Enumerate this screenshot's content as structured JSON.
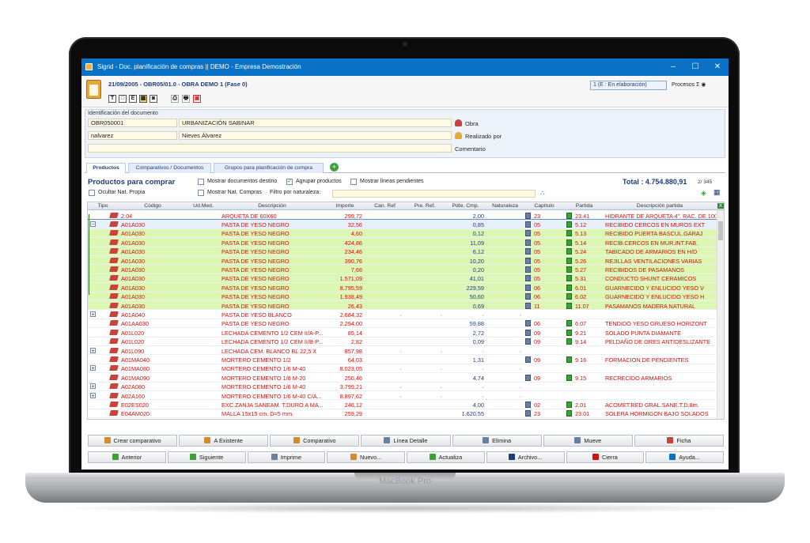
{
  "device": {
    "brand": "MacBook Pro"
  },
  "window": {
    "title": "Sigrid - Doc. planificación de compras || DEMO - Empresa Demostración",
    "min": "–",
    "max": "☐",
    "close": "✕"
  },
  "header": {
    "doc_ref": "21/09/2005 - OBR05/01.0 - OBRA DEMO 1 (Fase 0)",
    "state": "1 (E : En elaboración)",
    "procesos": "Procesos",
    "toolbar_icons": [
      "T",
      "□",
      "E",
      "▦",
      "◙",
      "⎙",
      "🖶",
      "▣"
    ]
  },
  "ident": {
    "label": "Identificación del documento",
    "obra_code": "OBR050001",
    "obra_name": "URBANIZACIÓN SABINAR",
    "obra_label": "Obra",
    "user_code": "nalvarez",
    "user_name": "Nieves Álvarez",
    "realizado_label": "Realizado por",
    "comentario_label": "Comentario"
  },
  "tabs": [
    "Productos",
    "Comparativos / Documentos",
    "Grupos para planificación de compra"
  ],
  "products": {
    "title": "Productos para comprar",
    "opts": {
      "ocultar": "Ocultar Nat. Propia",
      "mostrar_docs": "Mostrar documentos destino",
      "agrupar": "Agrupar productos",
      "pendientes": "Mostrar líneas pendientes",
      "mostrar_nat": "Mostrar Nat. Compras",
      "filtro": "Filtro por naturaleza:"
    },
    "total": "Total : 4.754.880,91",
    "pager": "2/ 345"
  },
  "grid": {
    "headers": [
      "Tipo",
      "Código",
      "Ud.Med.",
      "Descripción",
      "Importe",
      "Can. Ref",
      "Pre. Ref.",
      "Pdte. Cmp.",
      "Naturaleza",
      "Capítulo",
      "Partida",
      "Descripción partida"
    ],
    "rows": [
      {
        "style": "normal",
        "exp": "",
        "code": "2.04",
        "desc": "ARQUETA DE 60X60",
        "imp": "299,72",
        "can": "",
        "pre": "",
        "pdte": "2,00",
        "nat": "",
        "cap": "23",
        "par": "23.41",
        "dpar": "HIDRANTE DE ARQUETA 4\". RAC. DE 100"
      },
      {
        "style": "sel",
        "exp": "−",
        "code": "A01A030",
        "desc": "PASTA DE YESO NEGRO",
        "imp": "32,56",
        "can": "",
        "pre": "",
        "pdte": "0,85",
        "nat": "",
        "cap": "05",
        "par": "5.12",
        "dpar": "RECIBIDO CERCOS EN MUROS EXT"
      },
      {
        "style": "green",
        "exp": "",
        "code": "A01A030",
        "desc": "PASTA DE YESO NEGRO",
        "imp": "4,60",
        "can": "",
        "pre": "",
        "pdte": "0,12",
        "nat": "",
        "cap": "05",
        "par": "5.13",
        "dpar": "RECIBIDO PUERTA BASCUL.GARAJ"
      },
      {
        "style": "green",
        "exp": "",
        "code": "A01A030",
        "desc": "PASTA DE YESO NEGRO",
        "imp": "424,86",
        "can": "",
        "pre": "",
        "pdte": "11,09",
        "nat": "",
        "cap": "05",
        "par": "5.14",
        "dpar": "RECIB.CERCOS EN MUR.INT.FAB."
      },
      {
        "style": "green",
        "exp": "",
        "code": "A01A030",
        "desc": "PASTA DE YESO NEGRO",
        "imp": "234,46",
        "can": "",
        "pre": "",
        "pdte": "6,12",
        "nat": "",
        "cap": "05",
        "par": "5.24",
        "dpar": "TABICADO DE ARMARIOS EN H/D"
      },
      {
        "style": "green",
        "exp": "",
        "code": "A01A030",
        "desc": "PASTA DE YESO NEGRO",
        "imp": "390,76",
        "can": "",
        "pre": "",
        "pdte": "10,20",
        "nat": "",
        "cap": "05",
        "par": "5.26",
        "dpar": "REJILLAS VENTILACIONES VARIAS"
      },
      {
        "style": "green",
        "exp": "",
        "code": "A01A030",
        "desc": "PASTA DE YESO NEGRO",
        "imp": "7,66",
        "can": "",
        "pre": "",
        "pdte": "0,20",
        "nat": "",
        "cap": "05",
        "par": "5.27",
        "dpar": "RECIBIDOS DE PASAMANOS"
      },
      {
        "style": "green",
        "exp": "",
        "code": "A01A030",
        "desc": "PASTA DE YESO NEGRO",
        "imp": "1.571,09",
        "can": "",
        "pre": "",
        "pdte": "41,01",
        "nat": "",
        "cap": "05",
        "par": "5.31",
        "dpar": "CONDUCTO SHUNT CERAMICOS"
      },
      {
        "style": "green",
        "exp": "",
        "code": "A01A030",
        "desc": "PASTA DE YESO NEGRO",
        "imp": "8.795,59",
        "can": "",
        "pre": "",
        "pdte": "229,59",
        "nat": "",
        "cap": "06",
        "par": "6.01",
        "dpar": "GUARNECIDO Y ENLUCIDO YESO V"
      },
      {
        "style": "green",
        "exp": "",
        "code": "A01A030",
        "desc": "PASTA DE YESO NEGRO",
        "imp": "1.938,49",
        "can": "",
        "pre": "",
        "pdte": "50,60",
        "nat": "",
        "cap": "06",
        "par": "6.02",
        "dpar": "GUARNECIDO Y ENLUCIDO YESO H"
      },
      {
        "style": "green",
        "exp": "",
        "code": "A01A030",
        "desc": "PASTA DE YESO NEGRO",
        "imp": "26,43",
        "can": "",
        "pre": "",
        "pdte": "0,69",
        "nat": "",
        "cap": "11",
        "par": "11.07",
        "dpar": "PASAMANOS MADERA NATURAL"
      },
      {
        "style": "gray",
        "exp": "+",
        "code": "A01A040",
        "desc": "PASTA DE YESO BLANCO",
        "imp": "2.684,32",
        "can": "·",
        "pre": "·",
        "pdte": "·",
        "nat": "·",
        "cap": "",
        "par": "",
        "dpar": ""
      },
      {
        "style": "normal",
        "exp": "",
        "code": "A01AA030",
        "desc": "PASTA DE YESO NEGRO",
        "imp": "2.294,00",
        "can": "",
        "pre": "",
        "pdte": "59,88",
        "nat": "",
        "cap": "06",
        "par": "6.07",
        "dpar": "TENDIDO YESO GRUESO HORIZONT"
      },
      {
        "style": "normal",
        "exp": "",
        "code": "A01L020",
        "desc": "LECHADA CEMENTO 1/2 CEM II/A-P...",
        "imp": "85,14",
        "can": "",
        "pre": "",
        "pdte": "2,72",
        "nat": "",
        "cap": "09",
        "par": "9.21",
        "dpar": "SOLADO PUNTA DIAMANTE"
      },
      {
        "style": "normal",
        "exp": "",
        "code": "A01L020",
        "desc": "LECHADA CEMENTO 1/2 CEM II/B-P...",
        "imp": "2,82",
        "can": "",
        "pre": "",
        "pdte": "0,09",
        "nat": "",
        "cap": "09",
        "par": "9.14",
        "dpar": "PELDAÑO DE GRES ANTIDESLIZANTE"
      },
      {
        "style": "gray",
        "exp": "+",
        "code": "A01L090",
        "desc": "LECHADA CEM. BLANCO BL 22,5 X",
        "imp": "857,98",
        "can": "·",
        "pre": "·",
        "pdte": "·",
        "nat": "·",
        "cap": "",
        "par": "",
        "dpar": ""
      },
      {
        "style": "normal",
        "exp": "",
        "code": "A01MA040",
        "desc": "MORTERO CEMENTO 1/2",
        "imp": "64,03",
        "can": "",
        "pre": "",
        "pdte": "1,31",
        "nat": "",
        "cap": "09",
        "par": "9.16",
        "dpar": "FORMACION DE PENDIENTES"
      },
      {
        "style": "gray",
        "exp": "+",
        "code": "A01MA080",
        "desc": "MORTERO CEMENTO 1/6 M-40",
        "imp": "8.023,05",
        "can": "·",
        "pre": "·",
        "pdte": "·",
        "nat": "·",
        "cap": "",
        "par": "",
        "dpar": ""
      },
      {
        "style": "normal",
        "exp": "",
        "code": "A01MA090",
        "desc": "MORTERO CEMENTO 1/8 M-20",
        "imp": "250,46",
        "can": "",
        "pre": "",
        "pdte": "4,74",
        "nat": "",
        "cap": "09",
        "par": "9.15",
        "dpar": "RECRECIDO ARMARIOS"
      },
      {
        "style": "gray",
        "exp": "+",
        "code": "A02A080",
        "desc": "MORTERO CEMENTO 1/6 M-40",
        "imp": "3.799,21",
        "can": "·",
        "pre": "·",
        "pdte": "·",
        "nat": "·",
        "cap": "",
        "par": "",
        "dpar": ""
      },
      {
        "style": "gray",
        "exp": "+",
        "code": "A02A160",
        "desc": "MORTERO CEMENTO 1/6 M-40 C/A...",
        "imp": "8.897,62",
        "can": "·",
        "pre": "·",
        "pdte": "·",
        "nat": "·",
        "cap": "",
        "par": "",
        "dpar": ""
      },
      {
        "style": "normal",
        "exp": "",
        "code": "E02ES020",
        "desc": "EXC.ZANJA SANEAM. T.DURO A MA...",
        "imp": "246,12",
        "can": "",
        "pre": "",
        "pdte": "4,00",
        "nat": "",
        "cap": "02",
        "par": "2.01",
        "dpar": "ACOMET.RED GRAL.SANE.T.D.8m."
      },
      {
        "style": "normal",
        "exp": "",
        "code": "E04AM020",
        "desc": "MALLA 15x15 cm. D=5 mm.",
        "imp": "259,29",
        "can": "",
        "pre": "",
        "pdte": "1.620,55",
        "nat": "",
        "cap": "23",
        "par": "23.01",
        "dpar": "SOLERA HORMIGON BAJO SOLADOS"
      }
    ]
  },
  "buttons_row1": [
    {
      "label": "Crear comparativo",
      "color": "#d68a2e"
    },
    {
      "label": "A Existente",
      "color": "#d68a2e"
    },
    {
      "label": "Comparativo",
      "color": "#d68a2e"
    },
    {
      "label": "Línea Detalle",
      "color": "#6b7fa3"
    },
    {
      "label": "Elimina",
      "color": "#6b7fa3"
    },
    {
      "label": "Mueve",
      "color": "#6b7fa3"
    },
    {
      "label": "Ficha",
      "color": "#c9423b"
    }
  ],
  "buttons_row2": [
    {
      "label": "Anterior",
      "color": "#3aa335"
    },
    {
      "label": "Siguiente",
      "color": "#3aa335"
    },
    {
      "label": "Imprime",
      "color": "#6b7fa3"
    },
    {
      "label": "Nuevo...",
      "color": "#d68a2e"
    },
    {
      "label": "Actualiza",
      "color": "#3aa335"
    },
    {
      "label": "Archivo...",
      "color": "#1f3c7a"
    },
    {
      "label": "Cierra",
      "color": "#d21010"
    },
    {
      "label": "Ayuda...",
      "color": "#0a72c6"
    }
  ]
}
